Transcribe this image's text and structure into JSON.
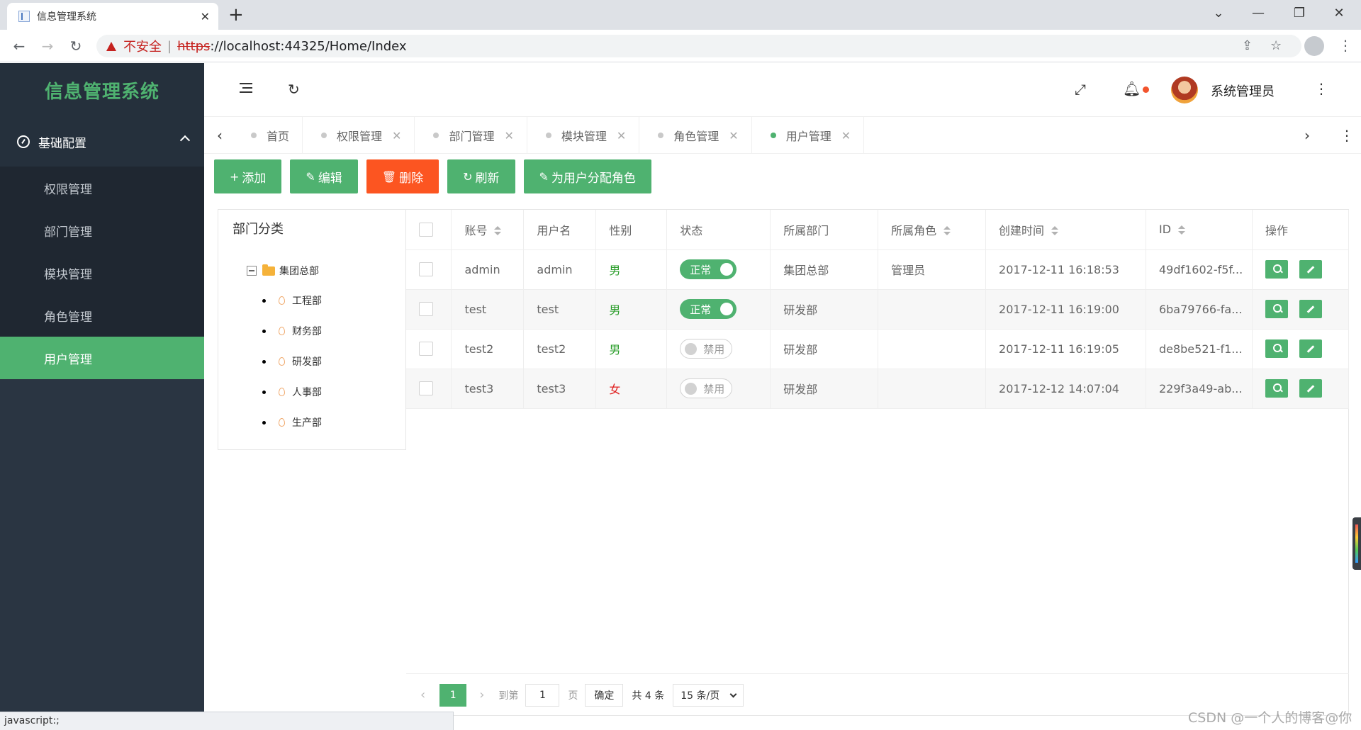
{
  "browser": {
    "tab_title": "信息管理系统",
    "tab_close": "✕",
    "new_tab": "+",
    "security_label": "不安全",
    "url_scheme": "https",
    "url_rest": "://localhost:44325/Home/Index"
  },
  "app": {
    "logo": "信息管理系统",
    "user_name": "系统管理员"
  },
  "sidebar": {
    "group_label": "基础配置",
    "items": [
      {
        "label": "权限管理",
        "active": false
      },
      {
        "label": "部门管理",
        "active": false
      },
      {
        "label": "模块管理",
        "active": false
      },
      {
        "label": "角色管理",
        "active": false
      },
      {
        "label": "用户管理",
        "active": true
      }
    ]
  },
  "page_tabs": [
    {
      "label": "首页",
      "closable": false,
      "active": false
    },
    {
      "label": "权限管理",
      "closable": true,
      "active": false
    },
    {
      "label": "部门管理",
      "closable": true,
      "active": false
    },
    {
      "label": "模块管理",
      "closable": true,
      "active": false
    },
    {
      "label": "角色管理",
      "closable": true,
      "active": false
    },
    {
      "label": "用户管理",
      "closable": true,
      "active": true
    }
  ],
  "toolbar": {
    "add": "添加",
    "edit": "编辑",
    "delete": "删除",
    "refresh": "刷新",
    "assign_role": "为用户分配角色"
  },
  "tree": {
    "title": "部门分类",
    "root": "集团总部",
    "children": [
      "工程部",
      "财务部",
      "研发部",
      "人事部",
      "生产部"
    ]
  },
  "table": {
    "columns": [
      "账号",
      "用户名",
      "性别",
      "状态",
      "所属部门",
      "所属角色",
      "创建时间",
      "ID",
      "操作"
    ],
    "rows": [
      {
        "account": "admin",
        "username": "admin",
        "sex": "男",
        "status": "正常",
        "status_on": true,
        "dept": "集团总部",
        "role": "管理员",
        "created": "2017-12-11 16:18:53",
        "id": "49df1602-f5f..."
      },
      {
        "account": "test",
        "username": "test",
        "sex": "男",
        "status": "正常",
        "status_on": true,
        "dept": "研发部",
        "role": "",
        "created": "2017-12-11 16:19:00",
        "id": "6ba79766-fa..."
      },
      {
        "account": "test2",
        "username": "test2",
        "sex": "男",
        "status": "禁用",
        "status_on": false,
        "dept": "研发部",
        "role": "",
        "created": "2017-12-11 16:19:05",
        "id": "de8be521-f1..."
      },
      {
        "account": "test3",
        "username": "test3",
        "sex": "女",
        "status": "禁用",
        "status_on": false,
        "dept": "研发部",
        "role": "",
        "created": "2017-12-12 14:07:04",
        "id": "229f3a49-ab..."
      }
    ]
  },
  "pager": {
    "current": "1",
    "goto_label": "到第",
    "goto_value": "1",
    "page_unit": "页",
    "confirm": "确定",
    "total": "共 4 条",
    "page_size": "15 条/页"
  },
  "status_bar": "javascript:;",
  "watermark": "CSDN @一个人的博客@你",
  "colors": {
    "accent": "#4fb270",
    "danger": "#fc5521",
    "sidebar": "#2a3542"
  }
}
